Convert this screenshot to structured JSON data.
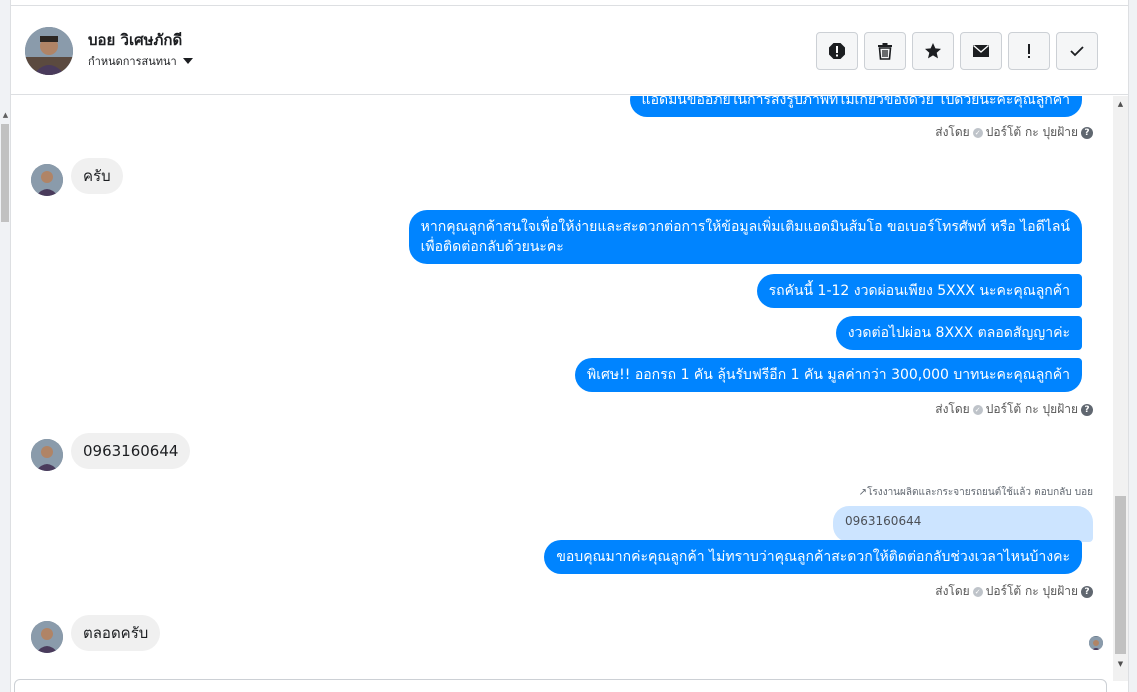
{
  "header": {
    "contact_name": "บอย วิเศษภักดี",
    "conversation_menu_label": "กำหนดการสนทนา",
    "toolbar": [
      {
        "name": "spam-button",
        "icon": "alert-octagon-icon"
      },
      {
        "name": "delete-button",
        "icon": "trash-icon"
      },
      {
        "name": "star-button",
        "icon": "star-icon"
      },
      {
        "name": "mark-unread-button",
        "icon": "envelope-icon"
      },
      {
        "name": "follow-up-button",
        "icon": "exclamation-icon"
      },
      {
        "name": "mark-done-button",
        "icon": "checkmark-icon"
      }
    ]
  },
  "messages": {
    "m0": "แอดมินขออภัยในการส่งรูปภาพที่ไม่เกี่ยวข้องด้วย ไปด้วยนะคะคุณลูกค้า",
    "sent_by_1": "ส่งโดย",
    "sender_1": "ปอร์โต้ กะ ปุยฝ้าย",
    "m1": "ครับ",
    "m2_line1": "หากคุณลูกค้าสนใจเพื่อให้ง่ายและสะดวกต่อการให้ข้อมูลเพิ่มเติมแอดมินส้มโอ ขอเบอร์โทรศัพท์ หรือ ไอดีไลน์",
    "m2_line2": "เพื่อติดต่อกลับด้วยนะคะ",
    "m3": "รถคันนี้ 1-12 งวดผ่อนเพียง 5XXX นะคะคุณลูกค้า",
    "m4": "งวดต่อไปผ่อน 8XXX ตลอดสัญญาค่ะ",
    "m5": "พิเศษ!! ออกรถ 1 คัน ลุ้นรับฟรีอีก 1 คัน มูลค่ากว่า 300,000 บาทนะคะคุณลูกค้า",
    "sent_by_2": "ส่งโดย",
    "sender_2": "ปอร์โต้ กะ ปุยฝ้าย",
    "m6": "0963160644",
    "reply_label": "โรงงานผลิตและกระจายรถยนต์ใช้แล้ว ตอบกลับ บอย",
    "quoted": "0963160644",
    "m7": "ขอบคุณมากค่ะคุณลูกค้า ไม่ทราบว่าคุณลูกค้าสะดวกให้ติดต่อกลับช่วงเวลาไหนบ้างคะ",
    "sent_by_3": "ส่งโดย",
    "sender_3": "ปอร์โต้ กะ ปุยฝ้าย",
    "m8": "ตลอดครับ"
  },
  "colors": {
    "outgoing_bubble": "#0084ff",
    "incoming_bubble": "#f0f0f0",
    "quoted_bubble": "#cce4ff"
  }
}
